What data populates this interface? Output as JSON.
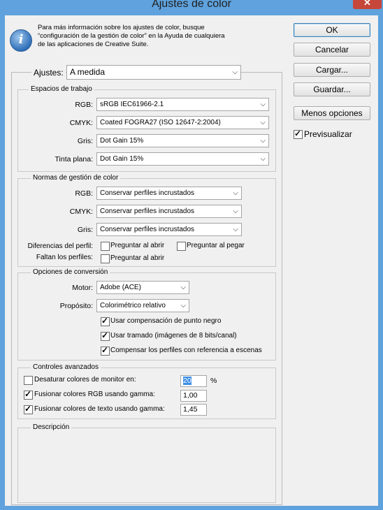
{
  "window": {
    "title": "Ajustes de color"
  },
  "info": {
    "lines": [
      "Para más información sobre los ajustes de color, busque",
      "“configuración de la gestión de color” en la Ayuda de cualquiera",
      "de las aplicaciones de Creative Suite."
    ]
  },
  "buttons": {
    "ok": "OK",
    "cancel": "Cancelar",
    "load": "Cargar...",
    "save": "Guardar...",
    "fewer": "Menos opciones"
  },
  "preview": {
    "label": "Previsualizar",
    "checked": true
  },
  "settings": {
    "label": "Ajustes:",
    "value": "A medida"
  },
  "workspaces": {
    "title": "Espacios de trabajo",
    "rgb": {
      "label": "RGB:",
      "value": "sRGB IEC61966-2.1"
    },
    "cmyk": {
      "label": "CMYK:",
      "value": "Coated FOGRA27 (ISO 12647-2:2004)"
    },
    "gray": {
      "label": "Gris:",
      "value": "Dot Gain 15%"
    },
    "spot": {
      "label": "Tinta plana:",
      "value": "Dot Gain 15%"
    }
  },
  "policies": {
    "title": "Normas de gestión de color",
    "rgb": {
      "label": "RGB:",
      "value": "Conservar perfiles incrustados"
    },
    "cmyk": {
      "label": "CMYK:",
      "value": "Conservar perfiles incrustados"
    },
    "gray": {
      "label": "Gris:",
      "value": "Conservar perfiles incrustados"
    },
    "mismatch_label": "Diferencias del perfil:",
    "ask_open": "Preguntar al abrir",
    "ask_paste": "Preguntar al pegar",
    "missing_label": "Faltan los perfiles:",
    "ask_open_missing": "Preguntar al abrir"
  },
  "conversion": {
    "title": "Opciones de conversión",
    "engine": {
      "label": "Motor:",
      "value": "Adobe (ACE)"
    },
    "intent": {
      "label": "Propósito:",
      "value": "Colorimétrico relativo"
    },
    "bpc": "Usar compensación de punto negro",
    "dither": "Usar tramado (imágenes de 8 bits/canal)",
    "scene": "Compensar los perfiles con referencia a escenas"
  },
  "advanced": {
    "title": "Controles avanzados",
    "desaturate": {
      "label": "Desaturar colores de monitor en:",
      "value": "20",
      "unit": "%",
      "checked": false
    },
    "blend_rgb": {
      "label": "Fusionar colores RGB usando gamma:",
      "value": "1,00",
      "checked": true
    },
    "blend_text": {
      "label": "Fusionar colores de texto usando gamma:",
      "value": "1,45",
      "checked": true
    }
  },
  "description": {
    "title": "Descripción"
  }
}
